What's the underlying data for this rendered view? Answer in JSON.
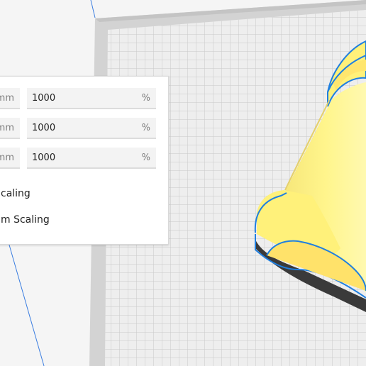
{
  "scale_panel": {
    "rows": [
      {
        "mm_unit": "mm",
        "percent_value": "1000",
        "percent_unit": "%"
      },
      {
        "mm_unit": "mm",
        "percent_value": "1000",
        "percent_unit": "%"
      },
      {
        "mm_unit": "mm",
        "percent_value": "1000",
        "percent_unit": "%"
      }
    ],
    "options": [
      "caling",
      "m Scaling"
    ]
  },
  "colors": {
    "build_plate": "#eeeeee",
    "grid_line": "#c8c8c8",
    "plate_border": "#c9c9c9",
    "model_fill": "#fff58c",
    "model_shadow": "#dcc85a",
    "selection_outline": "#1f7fe0",
    "underside_shadow": "#3a3a3a"
  }
}
